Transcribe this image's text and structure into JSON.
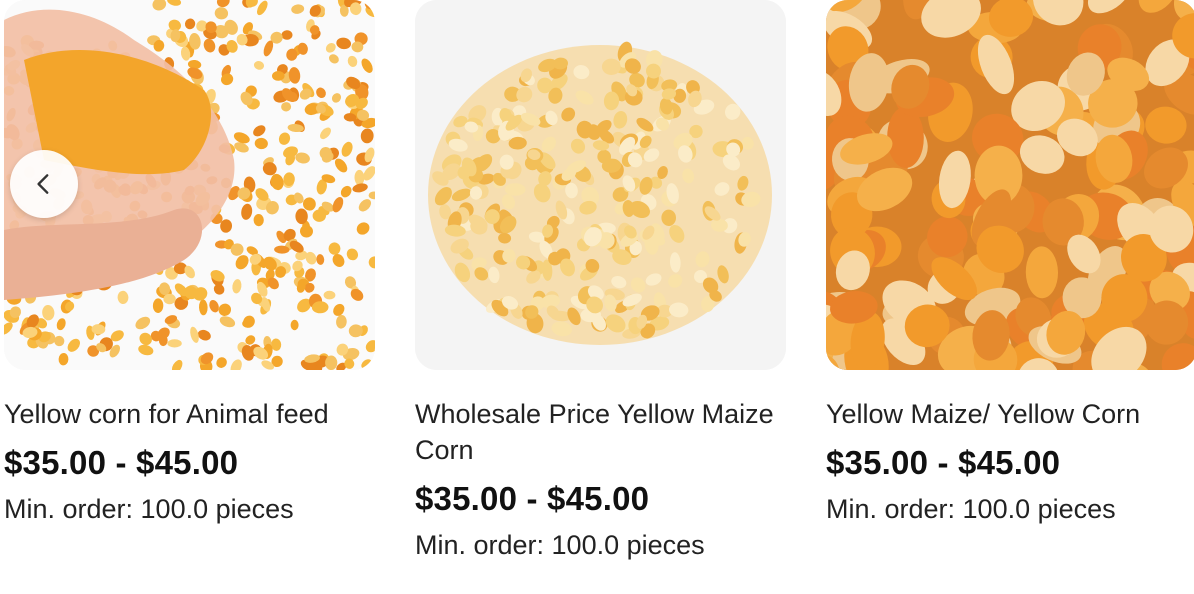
{
  "products": [
    {
      "title": "Yellow corn for Animal feed",
      "price": "$35.00 - $45.00",
      "moq": "Min. order: 100.0 pieces",
      "image": "corn-in-hands"
    },
    {
      "title": "Wholesale Price Yellow Maize Corn",
      "price": "$35.00 - $45.00",
      "moq": "Min. order: 100.0 pieces",
      "image": "popcorn-kernels-pile"
    },
    {
      "title": "Yellow Maize/ Yellow Corn",
      "price": "$35.00 - $45.00",
      "moq": "Min. order: 100.0 pieces",
      "image": "corn-kernels-closeup"
    }
  ],
  "carousel": {
    "prev_icon": "chevron-left-icon"
  },
  "colors": {
    "kernel_orange": "#f2a32c",
    "kernel_pale": "#f7e3b3",
    "skin": "#f0b8a0"
  }
}
